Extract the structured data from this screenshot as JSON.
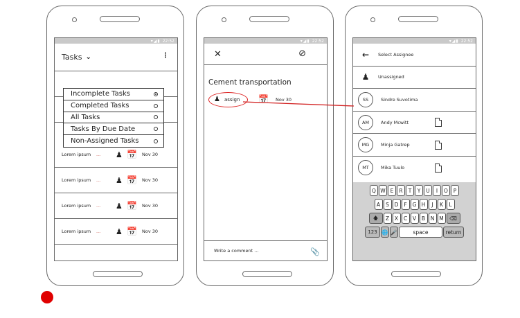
{
  "statusbar": {
    "time": "22:52"
  },
  "screen1": {
    "title": "Tasks",
    "filters": [
      {
        "label": "Incomplete Tasks",
        "selected": true
      },
      {
        "label": "Completed Tasks",
        "selected": false
      },
      {
        "label": "All Tasks",
        "selected": false
      },
      {
        "label": "Tasks By Due Date",
        "selected": false
      },
      {
        "label": "Non-Assigned Tasks",
        "selected": false
      }
    ],
    "rows": [
      {
        "text": "Lorem ipsum",
        "ellipsis": "...",
        "date": "Nov 30"
      },
      {
        "text": "Lorem ipsum",
        "ellipsis": "...",
        "date": "Nov 30"
      },
      {
        "text": "Lorem ipsum",
        "ellipsis": "...",
        "date": "Nov 30"
      },
      {
        "text": "Lorem ipsum",
        "ellipsis": "...",
        "date": "Nov 30"
      }
    ]
  },
  "screen2": {
    "task_title": "Cement transportation",
    "assign_label": "assign",
    "date": "Nov 30",
    "comment_placeholder": "Write a comment ..."
  },
  "screen3": {
    "title": "Select Assignee",
    "unassigned": "Unassigned",
    "people": [
      {
        "initials": "SS",
        "name": "Sindre Suvotima"
      },
      {
        "initials": "AM",
        "name": "Andy Mcwitt"
      },
      {
        "initials": "MG",
        "name": "Minja Gatrep"
      },
      {
        "initials": "MT",
        "name": "Mika Tuulo"
      }
    ]
  },
  "keyboard": {
    "row1": [
      "Q",
      "W",
      "E",
      "R",
      "T",
      "Y",
      "U",
      "I",
      "O",
      "P"
    ],
    "row2": [
      "A",
      "S",
      "D",
      "F",
      "G",
      "H",
      "J",
      "K",
      "L"
    ],
    "row3": [
      "Z",
      "X",
      "C",
      "V",
      "B",
      "N",
      "M"
    ],
    "numbers_key": "123",
    "space_key": "space",
    "return_key": "return"
  },
  "colors": {
    "accent_red": "#d22222",
    "dot_red": "#e00000"
  }
}
